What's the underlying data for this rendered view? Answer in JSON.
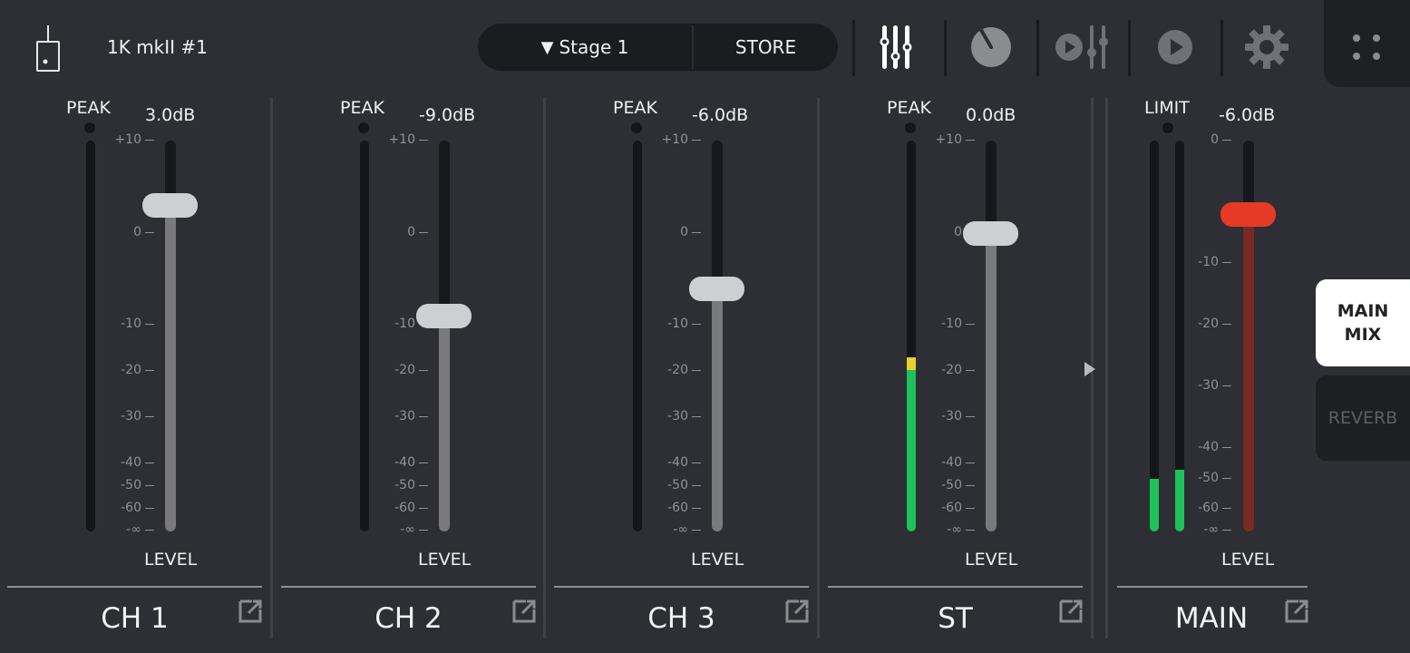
{
  "header": {
    "device_name": "1K mkII #1",
    "scene_label": "Stage 1",
    "store_label": "STORE"
  },
  "toolbar": {
    "icons": [
      "mixer-faders-icon",
      "knob-icon",
      "player-mixer-icon",
      "play-icon",
      "gear-icon",
      "menu-dots-icon"
    ]
  },
  "channels": [
    {
      "name": "CH 1",
      "peak_label": "PEAK",
      "gain": "3.0dB",
      "level_label": "LEVEL",
      "fader_db": 3.0,
      "meter_level": 0
    },
    {
      "name": "CH 2",
      "peak_label": "PEAK",
      "gain": "-9.0dB",
      "level_label": "LEVEL",
      "fader_db": -9.0,
      "meter_level": 0
    },
    {
      "name": "CH 3",
      "peak_label": "PEAK",
      "gain": "-6.0dB",
      "level_label": "LEVEL",
      "fader_db": -6.0,
      "meter_level": 0
    },
    {
      "name": "ST",
      "peak_label": "PEAK",
      "gain": "0.0dB",
      "level_label": "LEVEL",
      "fader_db": 0.0,
      "meter_level": -17
    }
  ],
  "main": {
    "name": "MAIN",
    "limit_label": "LIMIT",
    "gain": "-6.0dB",
    "level_label": "LEVEL",
    "fader_db": -6.0,
    "meter_left_db": -50,
    "meter_right_db": -47
  },
  "channel_scale": [
    "+10",
    "0",
    "-10",
    "-20",
    "-30",
    "-40",
    "-50",
    "-60",
    "-∞"
  ],
  "main_scale": [
    "0",
    "-10",
    "-20",
    "-30",
    "-40",
    "-50",
    "-60",
    "-∞"
  ],
  "tabs": {
    "main_mix": "MAIN\nMIX",
    "reverb": "REVERB"
  },
  "colors": {
    "background": "#2d2f34",
    "meter_green": "#1fc15a",
    "meter_yellow": "#e6d22a",
    "main_fader": "#e63a26",
    "main_track_fill": "#7a2a24"
  }
}
